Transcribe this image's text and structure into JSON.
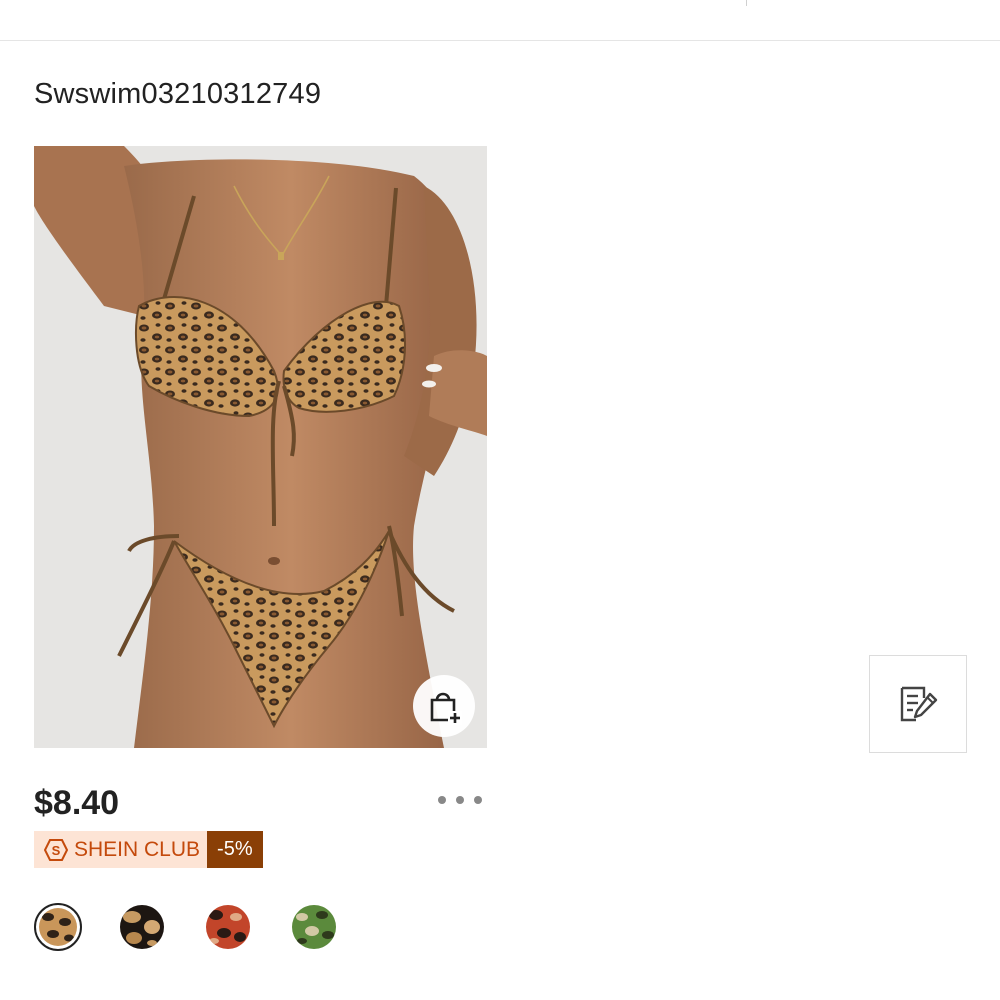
{
  "product": {
    "sku": "Swswim03210312749",
    "price": "$8.40",
    "club_label": "SHEIN CLUB",
    "club_discount": "-5%"
  },
  "icons": {
    "add_to_bag": "bag-plus-icon",
    "more": "more-horizontal-icon",
    "edit": "edit-note-icon",
    "club": "shein-club-s-icon"
  },
  "colors": {
    "club_bg": "#fde4d5",
    "club_text": "#c44a0c",
    "discount_bg": "#8a3f06"
  },
  "swatches": [
    {
      "name": "leopard-tan",
      "selected": true
    },
    {
      "name": "leopard-black-tan",
      "selected": false
    },
    {
      "name": "leopard-red",
      "selected": false
    },
    {
      "name": "leopard-green",
      "selected": false
    }
  ]
}
